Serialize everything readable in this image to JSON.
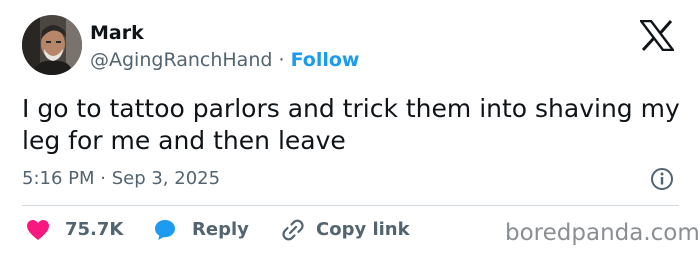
{
  "author": {
    "name": "Mark",
    "handle": "@AgingRanchHand",
    "separator": "·",
    "follow_label": "Follow",
    "avatar_icon": "profile-photo"
  },
  "platform_logo_icon": "x-logo-icon",
  "tweet": {
    "text": "I go to tattoo parlors and trick them into shaving my leg for me and then leave",
    "timestamp": "5:16 PM · Sep 3, 2025"
  },
  "actions": {
    "like": {
      "icon": "heart-icon",
      "count": "75.7K"
    },
    "reply": {
      "icon": "speech-bubble-icon",
      "label": "Reply"
    },
    "copy_link": {
      "icon": "link-icon",
      "label": "Copy link"
    }
  },
  "info_icon": "info-icon",
  "watermark": "boredpanda.com",
  "colors": {
    "text_primary": "#0f1419",
    "text_secondary": "#536471",
    "accent_blue": "#1d9bf0",
    "heart_red": "#f91880",
    "divider": "#cfd9de",
    "watermark": "#8a8f94"
  }
}
